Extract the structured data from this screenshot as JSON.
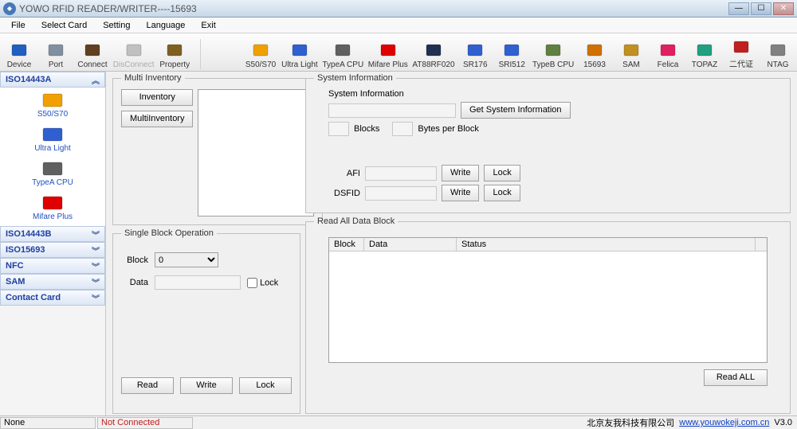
{
  "window": {
    "title": "YOWO RFID READER/WRITER----15693"
  },
  "menu": [
    "File",
    "Select Card",
    "Setting",
    "Language",
    "Exit"
  ],
  "toolbar": [
    {
      "label": "Device",
      "iconColor": "#2060c0",
      "svg": "gear"
    },
    {
      "label": "Port",
      "iconColor": "#8090a0",
      "svg": "port"
    },
    {
      "label": "Connect",
      "iconColor": "#604020",
      "svg": "plug"
    },
    {
      "label": "DisConnect",
      "iconColor": "#c0c0c0",
      "svg": "plug",
      "disabled": true
    },
    {
      "label": "Property",
      "iconColor": "#806020",
      "svg": "tools"
    }
  ],
  "toolbar_cards": [
    {
      "label": "S50/S70",
      "iconColor": "#f0a000"
    },
    {
      "label": "Ultra Light",
      "iconColor": "#3060d0"
    },
    {
      "label": "TypeA CPU",
      "iconColor": "#606060"
    },
    {
      "label": "Mifare Plus",
      "iconColor": "#e00000"
    },
    {
      "label": "AT88RF020",
      "iconColor": "#203050"
    },
    {
      "label": "SR176",
      "iconColor": "#3060d0"
    },
    {
      "label": "SRI512",
      "iconColor": "#3060d0"
    },
    {
      "label": "TypeB CPU",
      "iconColor": "#608040"
    },
    {
      "label": "15693",
      "iconColor": "#d07000"
    },
    {
      "label": "SAM",
      "iconColor": "#c09020"
    },
    {
      "label": "Felica",
      "iconColor": "#e02060"
    },
    {
      "label": "TOPAZ",
      "iconColor": "#20a080"
    },
    {
      "label": "二代证",
      "iconColor": "#c02020"
    },
    {
      "label": "NTAG",
      "iconColor": "#808080"
    }
  ],
  "sidebar": {
    "sections": [
      {
        "title": "ISO14443A",
        "open": true,
        "items": [
          {
            "label": "S50/S70",
            "iconColor": "#f0a000"
          },
          {
            "label": "Ultra Light",
            "iconColor": "#3060d0"
          },
          {
            "label": "TypeA CPU",
            "iconColor": "#606060"
          },
          {
            "label": "Mifare Plus",
            "iconColor": "#e00000"
          }
        ]
      },
      {
        "title": "ISO14443B",
        "open": false
      },
      {
        "title": "ISO15693",
        "open": false
      },
      {
        "title": "NFC",
        "open": false
      },
      {
        "title": "SAM",
        "open": false
      },
      {
        "title": "Contact Card",
        "open": false
      }
    ]
  },
  "multi_inventory": {
    "legend": "Multi Inventory",
    "btn_inventory": "Inventory",
    "btn_multi": "MultiInventory"
  },
  "system_info": {
    "legend": "System Information",
    "label_sysinfo": "System Information",
    "btn_get": "Get System Information",
    "label_blocks": "Blocks",
    "label_bpb": "Bytes per Block",
    "label_afi": "AFI",
    "label_dsfid": "DSFID",
    "btn_write": "Write",
    "btn_lock": "Lock"
  },
  "single_block": {
    "legend": "Single Block Operation",
    "label_block": "Block",
    "block_value": "0",
    "label_data": "Data",
    "label_lock": "Lock",
    "btn_read": "Read",
    "btn_write": "Write",
    "btn_lock": "Lock"
  },
  "data_block": {
    "legend": "Read All Data Block",
    "headers": [
      "Block",
      "Data",
      "Status"
    ],
    "btn_read_all": "Read ALL"
  },
  "status": {
    "left": "None",
    "conn": "Not Connected",
    "company": "北京友我科技有限公司",
    "url": "www.youwokeji.com.cn",
    "version": "V3.0"
  }
}
